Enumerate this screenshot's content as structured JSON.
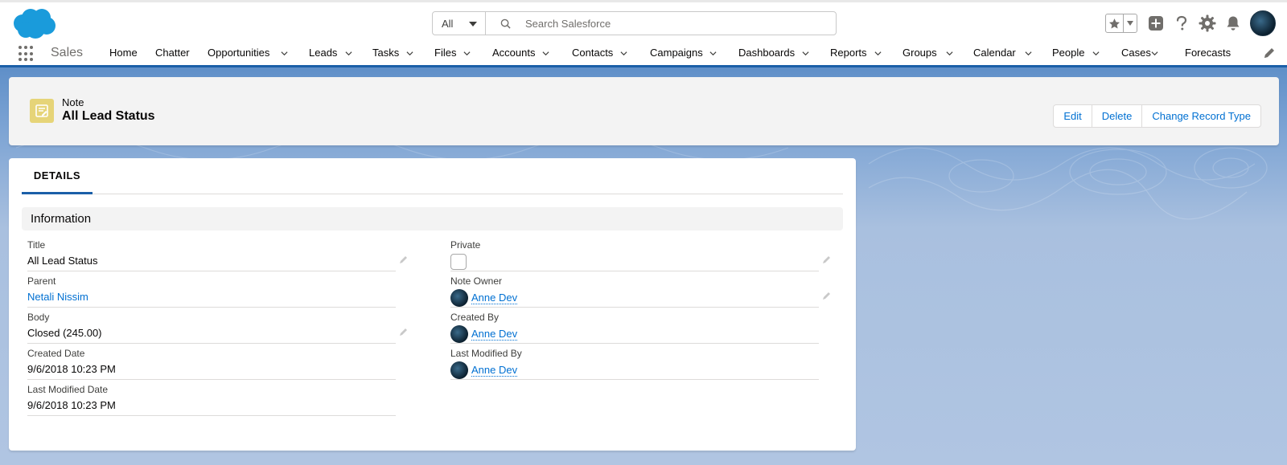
{
  "header": {
    "search_scope": "All",
    "search_placeholder": "Search Salesforce"
  },
  "nav": {
    "app_name": "Sales",
    "items": [
      {
        "label": "Home",
        "has_menu": false
      },
      {
        "label": "Chatter",
        "has_menu": false
      },
      {
        "label": "Opportunities",
        "has_menu": true
      },
      {
        "label": "Leads",
        "has_menu": true
      },
      {
        "label": "Tasks",
        "has_menu": true
      },
      {
        "label": "Files",
        "has_menu": true
      },
      {
        "label": "Accounts",
        "has_menu": true
      },
      {
        "label": "Contacts",
        "has_menu": true
      },
      {
        "label": "Campaigns",
        "has_menu": true
      },
      {
        "label": "Dashboards",
        "has_menu": true
      },
      {
        "label": "Reports",
        "has_menu": true
      },
      {
        "label": "Groups",
        "has_menu": true
      },
      {
        "label": "Calendar",
        "has_menu": true
      },
      {
        "label": "People",
        "has_menu": true
      },
      {
        "label": "Cases",
        "has_menu": true
      },
      {
        "label": "Forecasts",
        "has_menu": false
      }
    ]
  },
  "record": {
    "object_type": "Note",
    "title": "All Lead Status",
    "actions": [
      "Edit",
      "Delete",
      "Change Record Type"
    ]
  },
  "details": {
    "tab_label": "DETAILS",
    "section_title": "Information",
    "left_fields": [
      {
        "label": "Title",
        "value": "All Lead Status"
      },
      {
        "label": "Parent",
        "value": "Netali Nissim"
      },
      {
        "label": "Body",
        "value": "Closed (245.00)"
      },
      {
        "label": "Created Date",
        "value": "9/6/2018 10:23 PM"
      },
      {
        "label": "Last Modified Date",
        "value": "9/6/2018 10:23 PM"
      }
    ],
    "right_fields": [
      {
        "label": "Private",
        "value": ""
      },
      {
        "label": "Note Owner",
        "value": "Anne Dev"
      },
      {
        "label": "Created By",
        "value": "Anne Dev"
      },
      {
        "label": "Last Modified By",
        "value": "Anne Dev"
      }
    ]
  },
  "colors": {
    "brand_blue": "#1b5fa8",
    "link_blue": "#0070d2",
    "note_icon_bg": "#e6d478",
    "logo_blue": "#1a9bdb"
  }
}
